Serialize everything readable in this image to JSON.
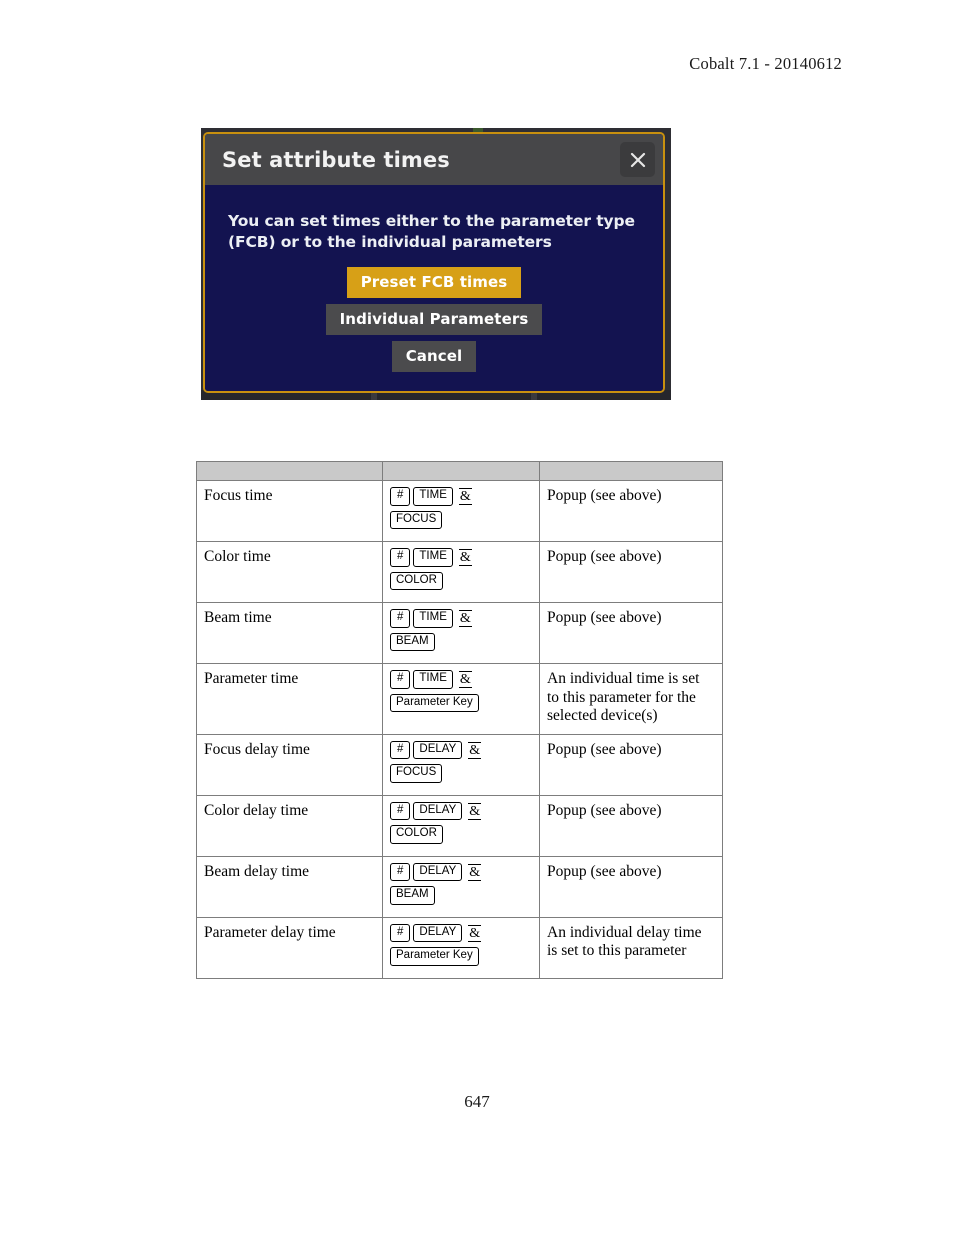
{
  "page": {
    "header": "Cobalt 7.1 - 20140612",
    "number": "647"
  },
  "dialog": {
    "title": "Set attribute times",
    "close_icon": "close-icon",
    "message": "You can set times either to the parameter type (FCB) or to the individual parameters",
    "buttons": [
      {
        "label": "Preset FCB times",
        "style": "primary"
      },
      {
        "label": "Individual Parameters",
        "style": "secondary"
      },
      {
        "label": "Cancel",
        "style": "secondary"
      }
    ],
    "colors": {
      "border": "#c8900f",
      "titlebar": "#474749",
      "body": "#131350",
      "primary_button": "#d7a017",
      "secondary_button": "#4b4b4d",
      "text": "#ffffff"
    }
  },
  "table": {
    "headers": [
      "",
      "",
      ""
    ],
    "rows": [
      {
        "label": "Focus time",
        "keys_line1": [
          "#",
          "TIME"
        ],
        "amp": "&",
        "keys_line2": [
          "FOCUS"
        ],
        "description": "Popup (see above)"
      },
      {
        "label": "Color time",
        "keys_line1": [
          "#",
          "TIME"
        ],
        "amp": "&",
        "keys_line2": [
          "COLOR"
        ],
        "description": "Popup (see above)"
      },
      {
        "label": "Beam time",
        "keys_line1": [
          "#",
          "TIME"
        ],
        "amp": "&",
        "keys_line2": [
          "BEAM"
        ],
        "description": "Popup (see above)"
      },
      {
        "label": "Parameter time",
        "keys_line1": [
          "#",
          "TIME"
        ],
        "amp": "&",
        "keys_line2": [
          "Parameter Key"
        ],
        "description": "An individual time is set to this parameter for the selected device(s)"
      },
      {
        "label": "Focus delay time",
        "keys_line1": [
          "#",
          "DELAY"
        ],
        "amp": "&",
        "keys_line2": [
          "FOCUS"
        ],
        "description": "Popup (see above)"
      },
      {
        "label": "Color delay time",
        "keys_line1": [
          "#",
          "DELAY"
        ],
        "amp": "&",
        "keys_line2": [
          "COLOR"
        ],
        "description": "Popup (see above)"
      },
      {
        "label": "Beam delay time",
        "keys_line1": [
          "#",
          "DELAY"
        ],
        "amp": "&",
        "keys_line2": [
          "BEAM"
        ],
        "description": "Popup (see above)"
      },
      {
        "label": "Parameter delay time",
        "keys_line1": [
          "#",
          "DELAY"
        ],
        "amp": "&",
        "keys_line2": [
          "Parameter Key"
        ],
        "description": "An individual delay time is set to this parameter"
      }
    ]
  }
}
